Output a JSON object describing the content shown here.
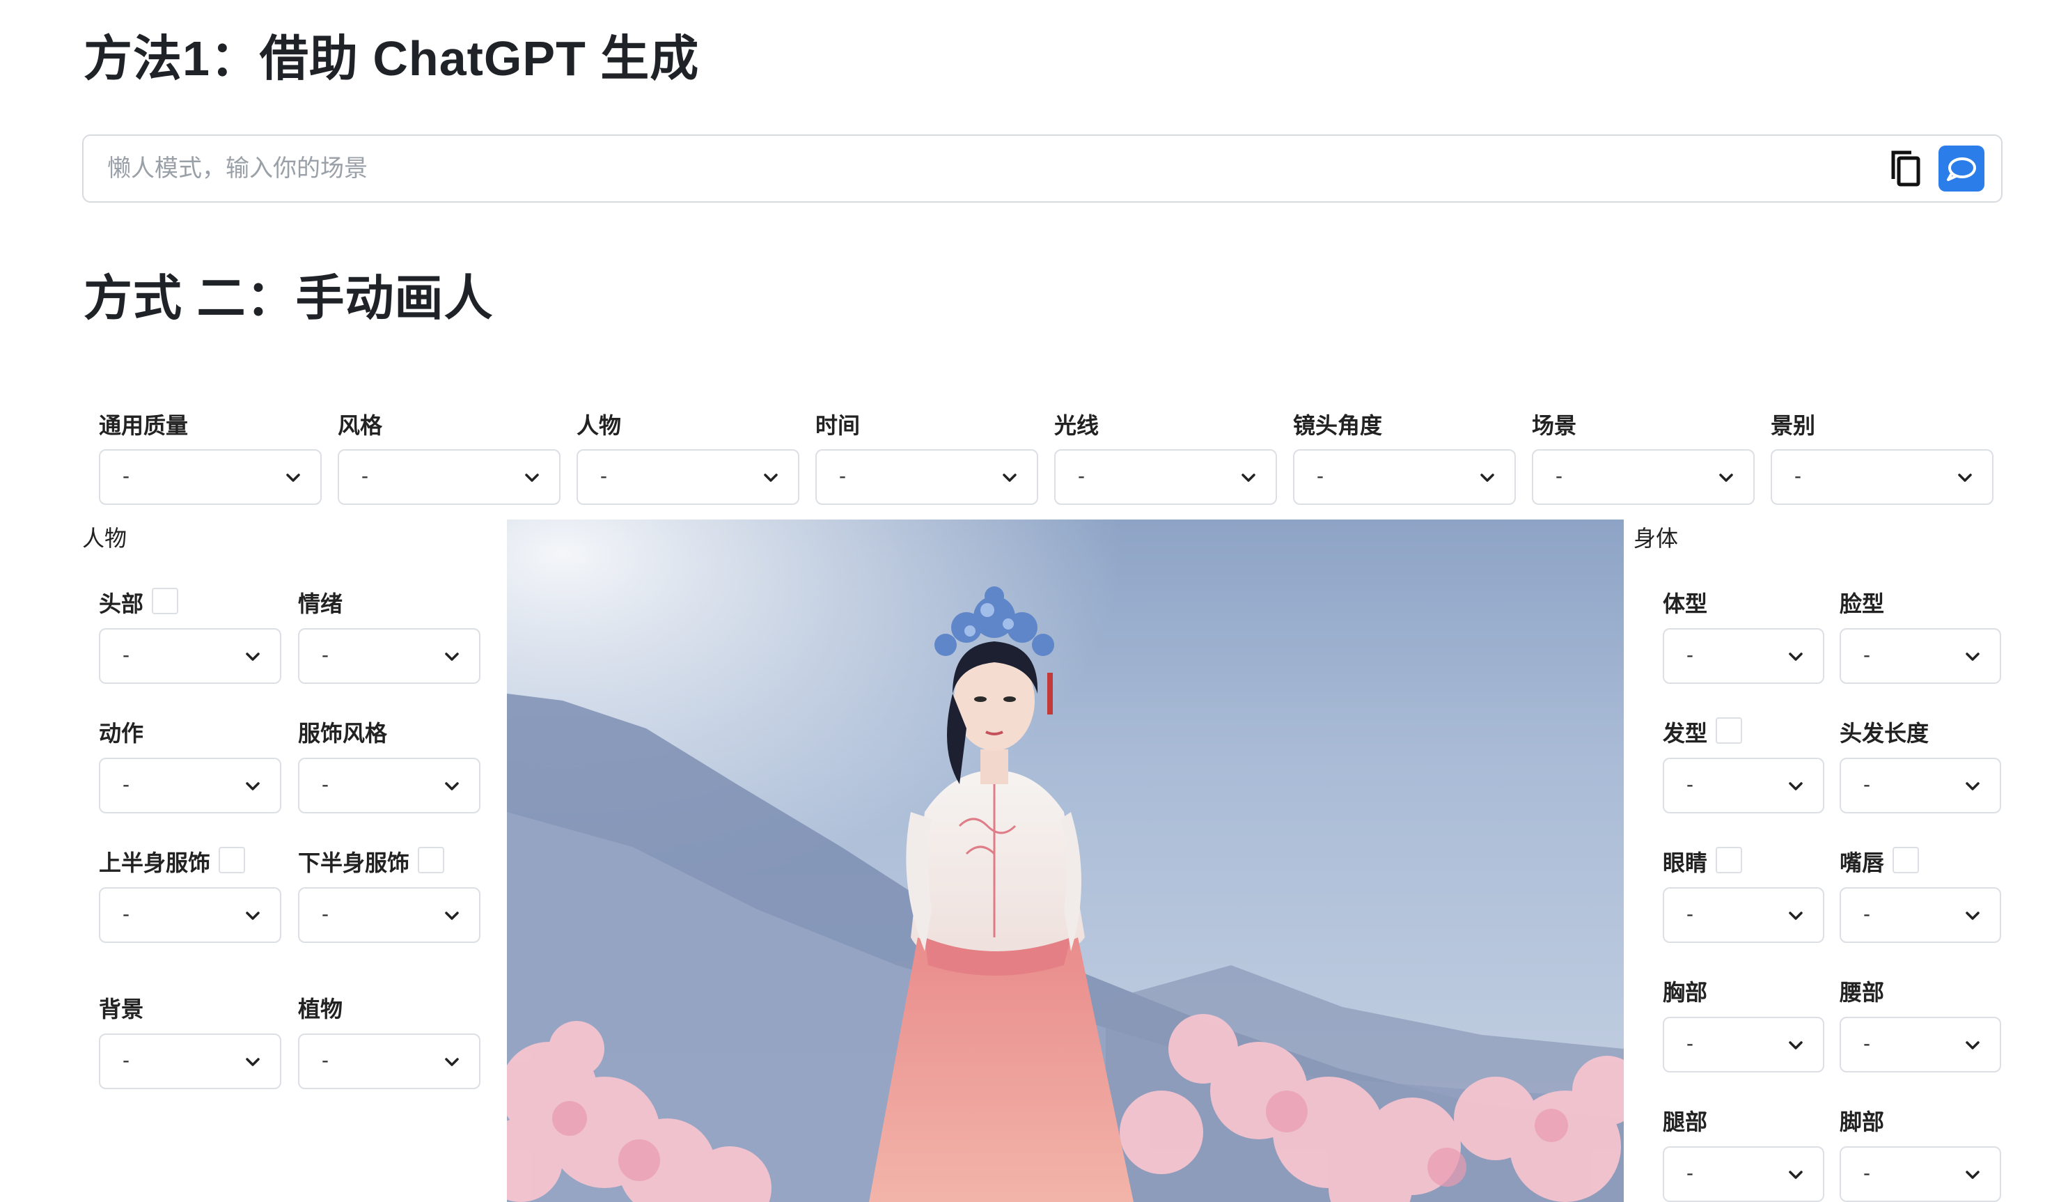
{
  "method1": {
    "title": "方法1：借助 ChatGPT 生成",
    "input_placeholder": "懒人模式，输入你的场景",
    "input_value": ""
  },
  "method2": {
    "title": "方式 二：手动画人"
  },
  "top_filters": [
    {
      "label": "通用质量",
      "value": "-"
    },
    {
      "label": "风格",
      "value": "-"
    },
    {
      "label": "人物",
      "value": "-"
    },
    {
      "label": "时间",
      "value": "-"
    },
    {
      "label": "光线",
      "value": "-"
    },
    {
      "label": "镜头角度",
      "value": "-"
    },
    {
      "label": "场景",
      "value": "-"
    },
    {
      "label": "景别",
      "value": "-"
    }
  ],
  "person_section": {
    "title": "人物",
    "fields": [
      {
        "label": "头部",
        "value": "-",
        "checkbox": true,
        "checked": false
      },
      {
        "label": "情绪",
        "value": "-",
        "checkbox": false
      },
      {
        "label": "动作",
        "value": "-",
        "checkbox": false
      },
      {
        "label": "服饰风格",
        "value": "-",
        "checkbox": false
      },
      {
        "label": "上半身服饰",
        "value": "-",
        "checkbox": true,
        "checked": false
      },
      {
        "label": "下半身服饰",
        "value": "-",
        "checkbox": true,
        "checked": false
      },
      {
        "label": "背景",
        "value": "-",
        "checkbox": false
      },
      {
        "label": "植物",
        "value": "-",
        "checkbox": false
      }
    ]
  },
  "body_section": {
    "title": "身体",
    "fields": [
      {
        "label": "体型",
        "value": "-",
        "checkbox": false
      },
      {
        "label": "脸型",
        "value": "-",
        "checkbox": false
      },
      {
        "label": "发型",
        "value": "-",
        "checkbox": true,
        "checked": false
      },
      {
        "label": "头发长度",
        "value": "-",
        "checkbox": false
      },
      {
        "label": "眼睛",
        "value": "-",
        "checkbox": true,
        "checked": false
      },
      {
        "label": "嘴唇",
        "value": "-",
        "checkbox": true,
        "checked": false
      },
      {
        "label": "胸部",
        "value": "-",
        "checkbox": false
      },
      {
        "label": "腰部",
        "value": "-",
        "checkbox": false
      },
      {
        "label": "腿部",
        "value": "-",
        "checkbox": false
      },
      {
        "label": "脚部",
        "value": "-",
        "checkbox": false
      }
    ]
  },
  "colors": {
    "accent": "#2b7de9",
    "border": "#dcdfe4",
    "text": "#1f2328",
    "placeholder": "#9aa0a8"
  },
  "icons": {
    "copy": "copy-icon",
    "chat": "chat-bubble-icon",
    "chevron": "chevron-down-icon"
  }
}
